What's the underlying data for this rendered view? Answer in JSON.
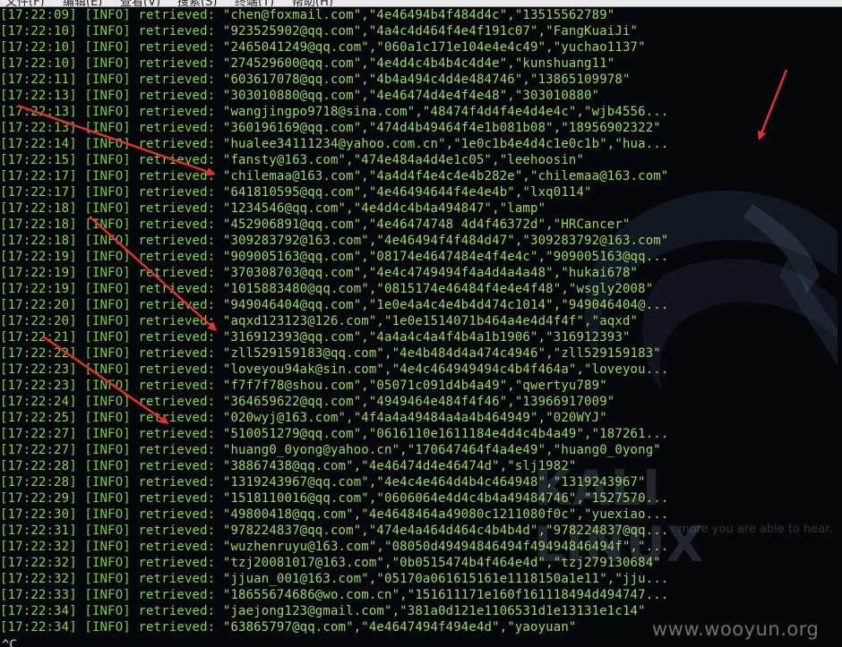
{
  "menubar": {
    "items": [
      "文件(F)",
      "编辑(E)",
      "查看(V)",
      "搜索(S)",
      "终端(T)",
      "帮助(H)"
    ]
  },
  "terminal": {
    "rows": [
      {
        "time": "[17:22:09]",
        "level": "[INFO]",
        "action": "retrieved:",
        "data": "\"chen@foxmail.com\",\"4e46494b4f484d4c\",\"13515562789\""
      },
      {
        "time": "[17:22:10]",
        "level": "[INFO]",
        "action": "retrieved:",
        "data": "\"923525902@qq.com\",\"4a4c4d464f4e4f191c07\",\"FangKuaiJi\""
      },
      {
        "time": "[17:22:10]",
        "level": "[INFO]",
        "action": "retrieved:",
        "data": "\"2465041249@qq.com\",\"060a1c171e104e4e4c49\",\"yuchao1137\""
      },
      {
        "time": "[17:22:10]",
        "level": "[INFO]",
        "action": "retrieved:",
        "data": "\"274529600@qq.com\",\"4e4d4c4b4b4c4d4e\",\"kunshuang11\""
      },
      {
        "time": "[17:22:11]",
        "level": "[INFO]",
        "action": "retrieved:",
        "data": "\"603617078@qq.com\",\"4b4a494c4d4e484746\",\"13865109978\""
      },
      {
        "time": "[17:22:13]",
        "level": "[INFO]",
        "action": "retrieved:",
        "data": "\"303010880@qq.com\",\"4e46474d4e4f4e48\",\"303010880\""
      },
      {
        "time": "[17:22:13]",
        "level": "[INFO]",
        "action": "retrieved:",
        "data": "\"wangjingpo9718@sina.com\",\"48474f4d4f4e4d4e4c\",\"wjb4556..."
      },
      {
        "time": "[17:22:13]",
        "level": "[INFO]",
        "action": "retrieved:",
        "data": "\"360196169@qq.com\",\"474d4b49464f4e1b081b08\",\"18956902322\""
      },
      {
        "time": "[17:22:14]",
        "level": "[INFO]",
        "action": "retrieved:",
        "data": "\"hualee34111234@yahoo.com.cn\",\"1e0c1b4e4d4c1e0c1b\",\"hua..."
      },
      {
        "time": "[17:22:15]",
        "level": "[INFO]",
        "action": "retrieved:",
        "data": "\"fansty@163.com\",\"474e484a4d4e1c05\",\"leehoosin\""
      },
      {
        "time": "[17:22:17]",
        "level": "[INFO]",
        "action": "retrieved:",
        "data": "\"chilemaa@163.com\",\"4a4d4f4e4c4e4b282e\",\"chilemaa@163.com\""
      },
      {
        "time": "[17:22:17]",
        "level": "[INFO]",
        "action": "retrieved:",
        "data": "\"641810595@qq.com\",\"4e46494644f4e4e4b\",\"lxq0114\""
      },
      {
        "time": "[17:22:18]",
        "level": "[INFO]",
        "action": "retrieved:",
        "data": "\"1234546@qq.com\",\"4e4d4c4b4a494847\",\"lamp\""
      },
      {
        "time": "[17:22:18]",
        "level": "[INFO]",
        "action": "retrieved:",
        "data": "\"452906891@qq.com\",\"4e46474748 4d4f46372d\",\"HRCancer\""
      },
      {
        "time": "[17:22:18]",
        "level": "[INFO]",
        "action": "retrieved:",
        "data": "\"309283792@163.com\",\"4e46494f4f484d47\",\"309283792@163.com\""
      },
      {
        "time": "[17:22:19]",
        "level": "[INFO]",
        "action": "retrieved:",
        "data": "\"909005163@qq.com\",\"08174e4647484e4f4e4c\",\"909005163@qq..."
      },
      {
        "time": "[17:22:19]",
        "level": "[INFO]",
        "action": "retrieved:",
        "data": "\"370308703@qq.com\",\"4e4c4749494f4a4d4a4a48\",\"hukai678\""
      },
      {
        "time": "[17:22:19]",
        "level": "[INFO]",
        "action": "retrieved:",
        "data": "\"1015883480@qq.com\",\"0815174e46484f4e4e4f48\",\"wsgly2008\""
      },
      {
        "time": "[17:22:20]",
        "level": "[INFO]",
        "action": "retrieved:",
        "data": "\"949046404@qq.com\",\"1e0e4a4c4e4b4d474c1014\",\"949046404@..."
      },
      {
        "time": "[17:22:20]",
        "level": "[INFO]",
        "action": "retrieved:",
        "data": "\"aqxd123123@126.com\",\"1e0e1514071b464a4e4d4f4f\",\"aqxd\""
      },
      {
        "time": "[17:22:21]",
        "level": "[INFO]",
        "action": "retrieved:",
        "data": "\"316912393@qq.com\",\"4a4a4c4a4f4b4a1b1906\",\"316912393\""
      },
      {
        "time": "[17:22:22]",
        "level": "[INFO]",
        "action": "retrieved:",
        "data": "\"zll529159183@qq.com\",\"4e4b484d4a474c4946\",\"zll529159183\""
      },
      {
        "time": "[17:22:23]",
        "level": "[INFO]",
        "action": "retrieved:",
        "data": "\"loveyou94ak@sin.com\",\"4e4c464949494c4b4f464a\",\"loveyou..."
      },
      {
        "time": "[17:22:23]",
        "level": "[INFO]",
        "action": "retrieved:",
        "data": "\"f7f7f78@shou.com\",\"05071c091d4b4a49\",\"qwertyu789\""
      },
      {
        "time": "[17:22:24]",
        "level": "[INFO]",
        "action": "retrieved:",
        "data": "\"364659622@qq.com\",\"4949464e484f4f46\",\"13966917009\""
      },
      {
        "time": "[17:22:25]",
        "level": "[INFO]",
        "action": "retrieved:",
        "data": "\"020wyj@163.com\",\"4f4a4a49484a4a4b464949\",\"020WYJ\""
      },
      {
        "time": "[17:22:27]",
        "level": "[INFO]",
        "action": "retrieved:",
        "data": "\"510051279@qq.com\",\"0616110e1611184e4d4c4b4a49\",\"187261..."
      },
      {
        "time": "[17:22:27]",
        "level": "[INFO]",
        "action": "retrieved:",
        "data": "\"huang0_0yong@yahoo.cn\",\"170647464f4a4e49\",\"huang0_0yong\""
      },
      {
        "time": "[17:22:28]",
        "level": "[INFO]",
        "action": "retrieved:",
        "data": "\"38867438@qq.com\",\"4e46474d4e46474d\",\"slj1982\""
      },
      {
        "time": "[17:22:28]",
        "level": "[INFO]",
        "action": "retrieved:",
        "data": "\"1319243967@qq.com\",\"4e4c4e464d4b4c464948\",\"1319243967\""
      },
      {
        "time": "[17:22:29]",
        "level": "[INFO]",
        "action": "retrieved:",
        "data": "\"1518110016@qq.com\",\"0606064e4d4c4b4a49484746\",\"1527570..."
      },
      {
        "time": "[17:22:30]",
        "level": "[INFO]",
        "action": "retrieved:",
        "data": "\"49800418@qq.com\",\"4e4648464a49080c1211080f0c\",\"yuexiao..."
      },
      {
        "time": "[17:22:31]",
        "level": "[INFO]",
        "action": "retrieved:",
        "data": "\"978224837@qq.com\",\"474e4a464d464c4b4b4d\",\"978224837@qq..."
      },
      {
        "time": "[17:22:32]",
        "level": "[INFO]",
        "action": "retrieved:",
        "data": "\"wuzhenruyu@163.com\",\"08050d49494846494f49494846494f\",\"..."
      },
      {
        "time": "[17:22:32]",
        "level": "[INFO]",
        "action": "retrieved:",
        "data": "\"tzj20081017@163.com\",\"0b0515474b4f464e4d\",\"tzj279130684\""
      },
      {
        "time": "[17:22:32]",
        "level": "[INFO]",
        "action": "retrieved:",
        "data": "\"jjuan_001@163.com\",\"05170a061615161e1118150a1e11\",\"jju..."
      },
      {
        "time": "[17:22:33]",
        "level": "[INFO]",
        "action": "retrieved:",
        "data": "\"18655674686@wo.com.cn\",\"151611171e160f161118494d494747..."
      },
      {
        "time": "[17:22:34]",
        "level": "[INFO]",
        "action": "retrieved:",
        "data": "\"jaejong123@gmail.com\",\"381a0d121e1106531d1e13131e1c14\""
      },
      {
        "time": "[17:22:34]",
        "level": "[INFO]",
        "action": "retrieved:",
        "data": "\"63865797@qq.com\",\"4e4647494f494e4d\",\"yaoyuan\""
      }
    ],
    "prompt": "^C"
  },
  "background": {
    "logo_text": "KALI LINUX",
    "tagline": "more you are able to hear."
  },
  "watermark": "www.wooyun.org",
  "colors": {
    "terminal_bg": "#05070b",
    "text": "#7fcf3a",
    "arrow": "#e0322c"
  }
}
